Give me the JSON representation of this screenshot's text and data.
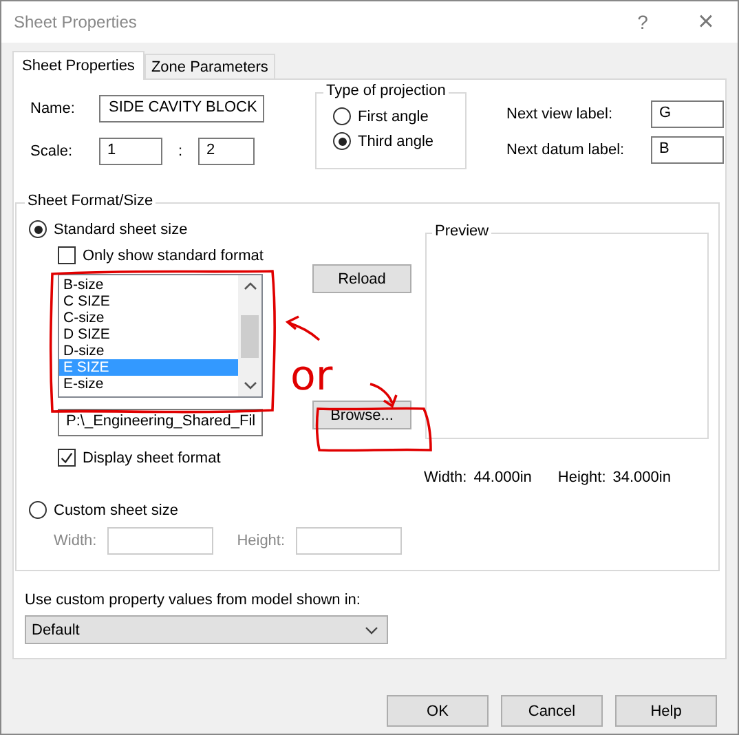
{
  "window": {
    "title": "Sheet Properties",
    "help": "?",
    "close": "×"
  },
  "tabs": [
    {
      "label": "Sheet Properties",
      "selected": true
    },
    {
      "label": "Zone Parameters",
      "selected": false
    }
  ],
  "name": {
    "label": "Name:",
    "value": "SIDE CAVITY BLOCK"
  },
  "scale": {
    "label": "Scale:",
    "numerator": "1",
    "separator": ":",
    "denominator": "2"
  },
  "projection": {
    "title": "Type of projection",
    "options": [
      {
        "label": "First angle",
        "selected": false
      },
      {
        "label": "Third angle",
        "selected": true
      }
    ]
  },
  "next_view_label": {
    "label": "Next view label:",
    "value": "G"
  },
  "next_datum_label": {
    "label": "Next datum label:",
    "value": "B"
  },
  "sheet_format": {
    "title": "Sheet Format/Size",
    "standard_sheet_size": {
      "label": "Standard sheet size",
      "selected": true
    },
    "only_show_standard_format": {
      "label": "Only show standard format",
      "checked": false
    },
    "sizes": [
      {
        "label": "B-size",
        "selected": false
      },
      {
        "label": "C SIZE",
        "selected": false
      },
      {
        "label": "C-size",
        "selected": false
      },
      {
        "label": "D SIZE",
        "selected": false
      },
      {
        "label": "D-size",
        "selected": false
      },
      {
        "label": "E SIZE",
        "selected": true
      },
      {
        "label": "E-size",
        "selected": false
      }
    ],
    "reload_button": "Reload",
    "format_path": "P:\\_Engineering_Shared_Fil",
    "browse_button": "Browse...",
    "display_sheet_format": {
      "label": "Display sheet format",
      "checked": true
    },
    "preview": {
      "title": "Preview"
    },
    "width": {
      "label": "Width:",
      "value": "44.000in"
    },
    "height": {
      "label": "Height:",
      "value": "34.000in"
    },
    "custom_sheet_size": {
      "label": "Custom sheet size",
      "selected": false
    },
    "custom_width": {
      "label": "Width:",
      "disabled": true
    },
    "custom_height": {
      "label": "Height:",
      "disabled": true
    }
  },
  "custom_property": {
    "label": "Use custom property values from model shown in:",
    "value": "Default"
  },
  "buttons": [
    "OK",
    "Cancel",
    "Help"
  ],
  "annotation": {
    "text": "or"
  }
}
